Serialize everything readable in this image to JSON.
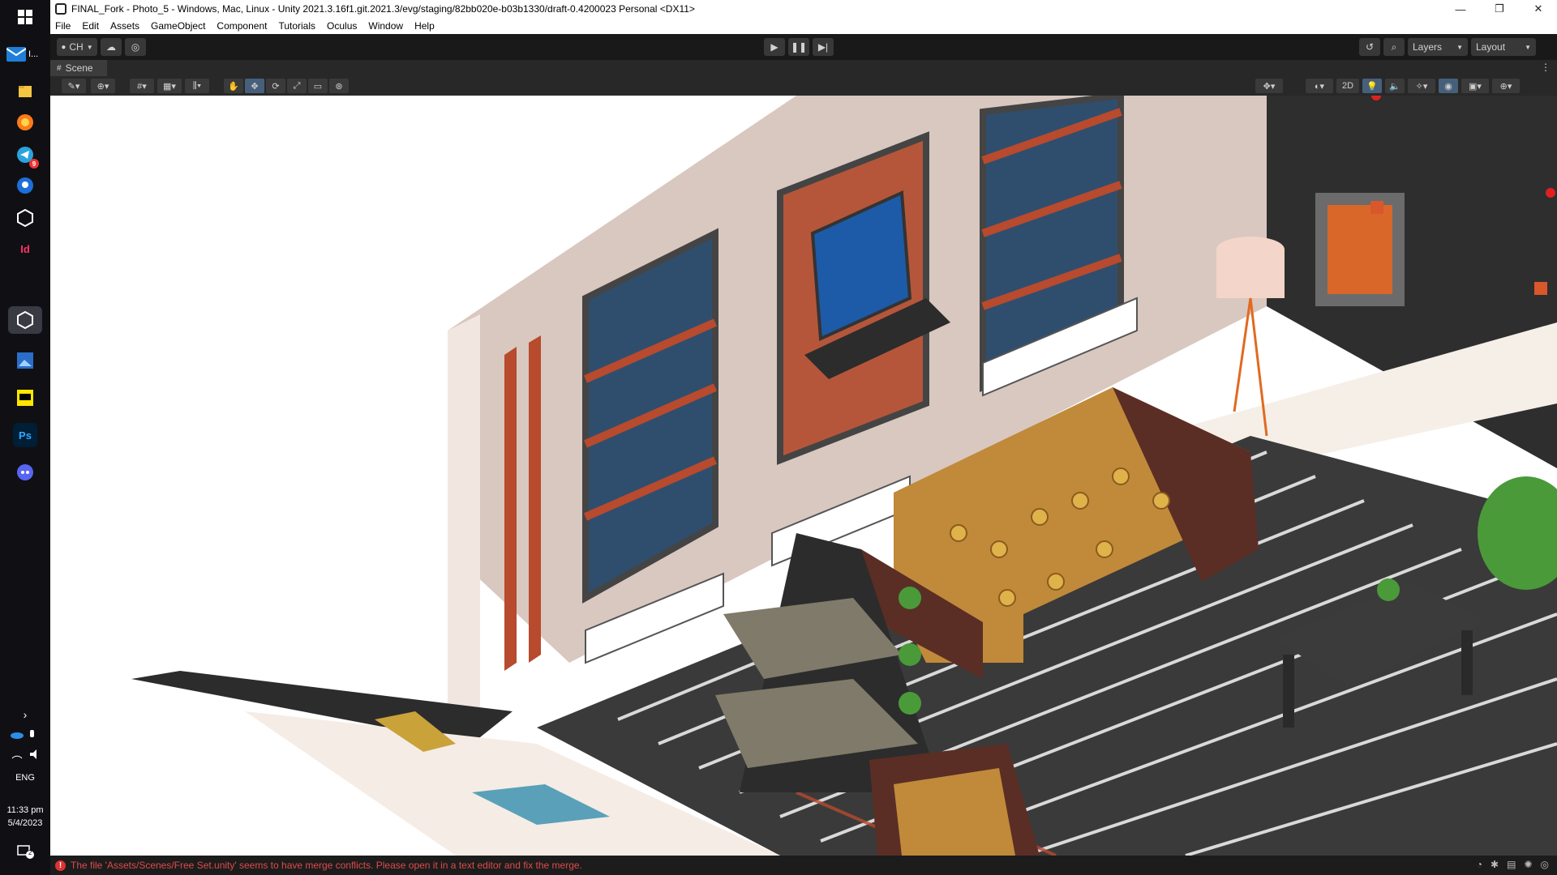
{
  "window": {
    "title": "FINAL_Fork - Photo_5 - Windows, Mac, Linux - Unity 2021.3.16f1.git.2021.3/evg/staging/82bb020e-b03b1330/draft-0.4200023 Personal <DX11>"
  },
  "menu": [
    "File",
    "Edit",
    "Assets",
    "GameObject",
    "Component",
    "Tutorials",
    "Oculus",
    "Window",
    "Help"
  ],
  "toolbar": {
    "account_label": "CH",
    "layers_label": "Layers",
    "layout_label": "Layout"
  },
  "scene_tab": {
    "label": "Scene"
  },
  "scene_toolbar": {
    "mode_2d": "2D"
  },
  "taskbar": {
    "mail_label": "I...",
    "indesign_label": "Id",
    "ps_label": "Ps",
    "notif_count": "9",
    "language": "ENG",
    "time": "11:33 pm",
    "date": "5/4/2023",
    "notification_badge": "2"
  },
  "status": {
    "message": "The file 'Assets/Scenes/Free Set.unity' seems to have merge conflicts. Please open it in a text editor and fix the merge."
  },
  "icons": {
    "windows": "windows-logo-icon",
    "play": "play-icon",
    "pause": "pause-icon",
    "step": "step-icon",
    "history": "history-icon",
    "search": "search-icon"
  }
}
